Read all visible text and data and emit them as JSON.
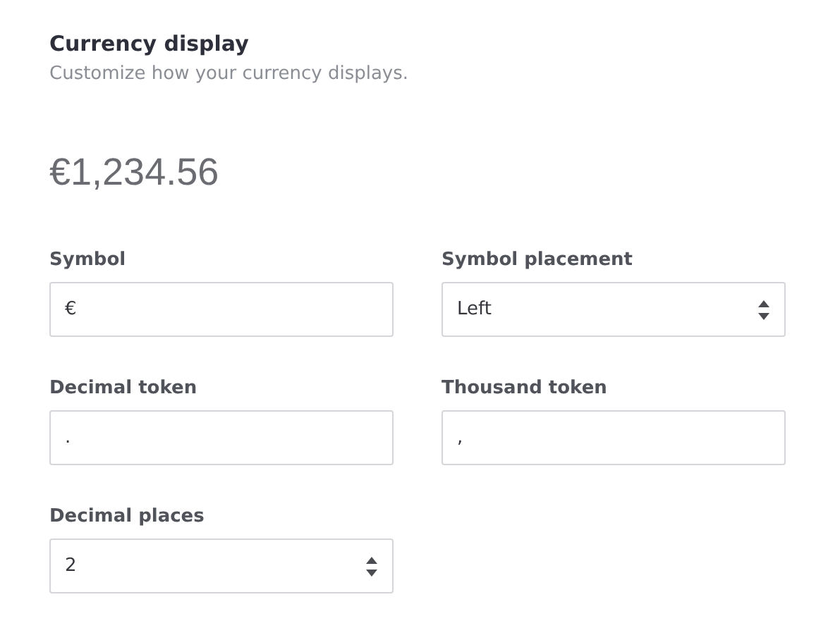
{
  "header": {
    "title": "Currency display",
    "subtitle": "Customize how your currency displays."
  },
  "preview": "€1,234.56",
  "fields": [
    {
      "label": "Symbol",
      "kind": "text",
      "value": "€"
    },
    {
      "label": "Symbol placement",
      "kind": "select",
      "value": "Left"
    },
    {
      "label": "Decimal token",
      "kind": "text",
      "value": "."
    },
    {
      "label": "Thousand token",
      "kind": "text",
      "value": ","
    },
    {
      "label": "Decimal places",
      "kind": "number",
      "value": "2"
    }
  ]
}
